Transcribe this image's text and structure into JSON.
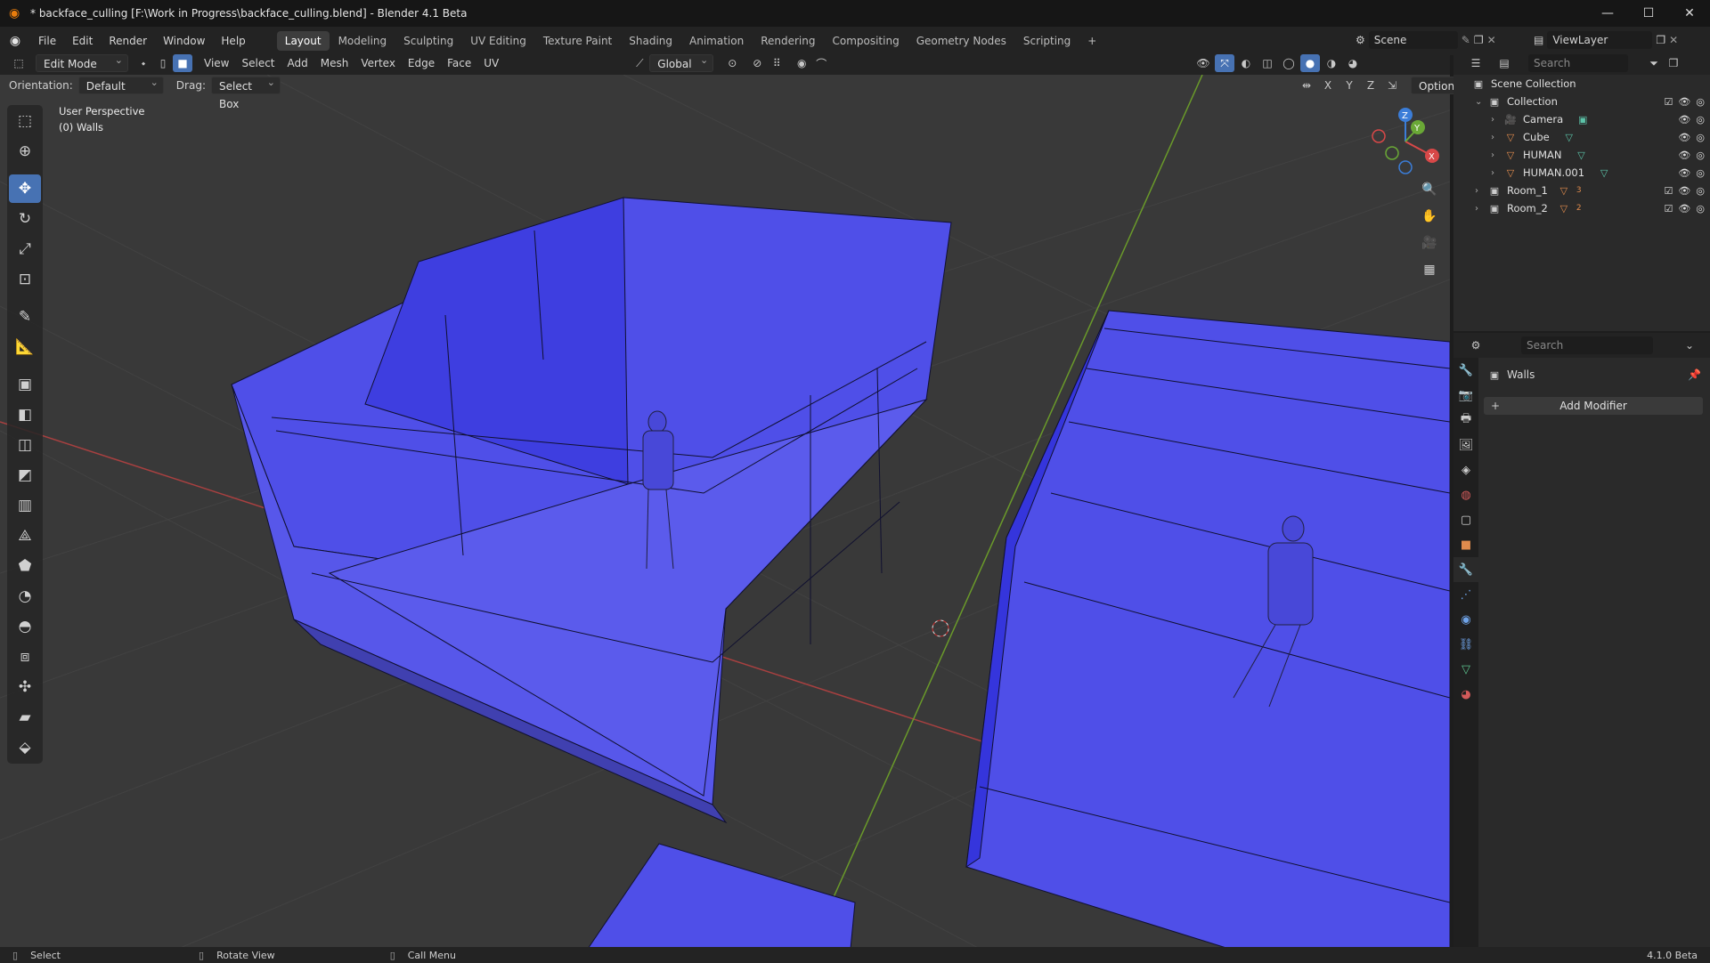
{
  "window": {
    "title": "* backface_culling [F:\\Work in Progress\\backface_culling.blend] - Blender 4.1 Beta",
    "minimize": "—",
    "maximize": "☐",
    "close": "✕"
  },
  "menu": [
    "File",
    "Edit",
    "Render",
    "Window",
    "Help"
  ],
  "workspaces": [
    "Layout",
    "Modeling",
    "Sculpting",
    "UV Editing",
    "Texture Paint",
    "Shading",
    "Animation",
    "Rendering",
    "Compositing",
    "Geometry Nodes",
    "Scripting"
  ],
  "active_workspace": "Layout",
  "scene": {
    "name": "Scene",
    "view_layer": "ViewLayer"
  },
  "header": {
    "mode": "Edit Mode",
    "menus": [
      "View",
      "Select",
      "Add",
      "Mesh",
      "Vertex",
      "Edge",
      "Face",
      "UV"
    ],
    "transform_orientation": "Global",
    "orientation_label": "Orientation:",
    "orientation_value": "Default",
    "drag_label": "Drag:",
    "drag_value": "Select Box",
    "axes": [
      "X",
      "Y",
      "Z"
    ],
    "options_label": "Options"
  },
  "viewport": {
    "view_name": "User Perspective",
    "object_info": "(0) Walls",
    "mesh_color": "#4f4fe8",
    "gizmo_axes": {
      "x": "X",
      "y": "Y",
      "z": "Z"
    }
  },
  "outliner": {
    "search_placeholder": "Search",
    "rows": [
      {
        "label": "Scene Collection",
        "indent": 0
      },
      {
        "label": "Collection",
        "indent": 1
      },
      {
        "label": "Camera",
        "indent": 2
      },
      {
        "label": "Cube",
        "indent": 2
      },
      {
        "label": "HUMAN",
        "indent": 2
      },
      {
        "label": "HUMAN.001",
        "indent": 2
      },
      {
        "label": "Room_1",
        "indent": 1,
        "badge": "3"
      },
      {
        "label": "Room_2",
        "indent": 1,
        "badge": "2"
      }
    ]
  },
  "properties": {
    "search_placeholder": "Search",
    "object_name": "Walls",
    "add_modifier": "Add Modifier"
  },
  "status": {
    "select": "Select",
    "rotate": "Rotate View",
    "call_menu": "Call Menu",
    "version": "4.1.0 Beta"
  }
}
